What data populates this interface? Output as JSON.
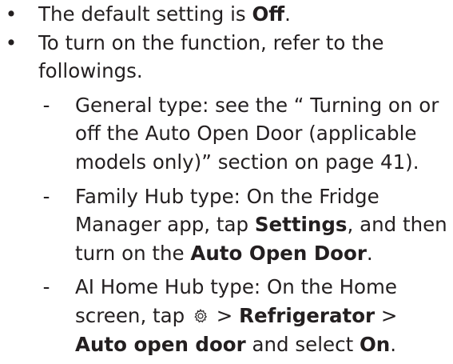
{
  "bullet_glyph": "•",
  "dash_glyph": "-",
  "item1": {
    "text": "The default setting is ",
    "bold": "Off",
    "end": "."
  },
  "item2": {
    "text": "To turn on the function, refer to the followings."
  },
  "general": {
    "text": "General type: see the “ Turning on or off the Auto Open Door (applicable models only)” section on page 41)."
  },
  "family": {
    "t1": "Family Hub type: On the Fridge Manager app, tap ",
    "b1": "Settings",
    "t2": ", and then turn on the ",
    "b2": "Auto Open Door",
    "t3": "."
  },
  "ai": {
    "t1": "AI Home Hub type: On the Home screen, tap ",
    "icon": "gear-icon",
    "t2": " > ",
    "b1": "Refrigerator",
    "t3": " > ",
    "b2": "Auto open door",
    "t4": " and select ",
    "b3": "On",
    "t5": "."
  }
}
